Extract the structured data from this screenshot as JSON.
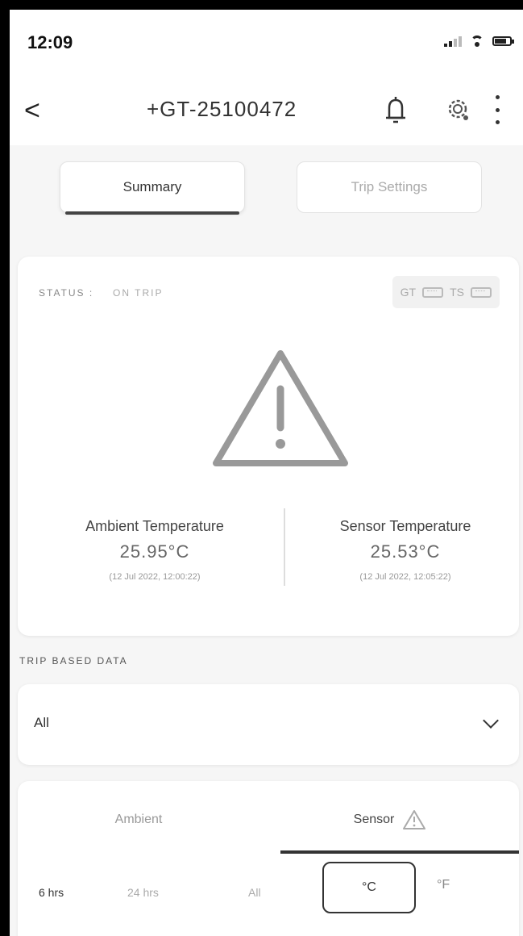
{
  "status_bar": {
    "time": "12:09"
  },
  "header": {
    "back_glyph": "<",
    "title": "+GT-25100472"
  },
  "tabs": [
    {
      "label": "Summary",
      "active": true
    },
    {
      "label": "Trip Settings",
      "active": false
    }
  ],
  "status_card": {
    "status_label": "STATUS :",
    "status_value": "ON TRIP",
    "badges": [
      "GT",
      "TS"
    ],
    "ambient": {
      "label": "Ambient Temperature",
      "value": "25.95°C",
      "time": "(12 Jul 2022, 12:00:22)"
    },
    "sensor": {
      "label": "Sensor Temperature",
      "value": "25.53°C",
      "time": "(12 Jul 2022, 12:05:22)"
    }
  },
  "trip_section": {
    "label": "TRIP BASED DATA"
  },
  "filter": {
    "value": "All"
  },
  "data_tabs": [
    {
      "label": "Ambient",
      "active": false
    },
    {
      "label": "Sensor",
      "active": true,
      "icon": "warning-icon"
    }
  ],
  "range_options": [
    "6 hrs",
    "24 hrs",
    "All"
  ],
  "units": [
    "°C",
    "°F"
  ],
  "colors": {
    "accent": "#333333",
    "warning": "#a0a0a0"
  }
}
